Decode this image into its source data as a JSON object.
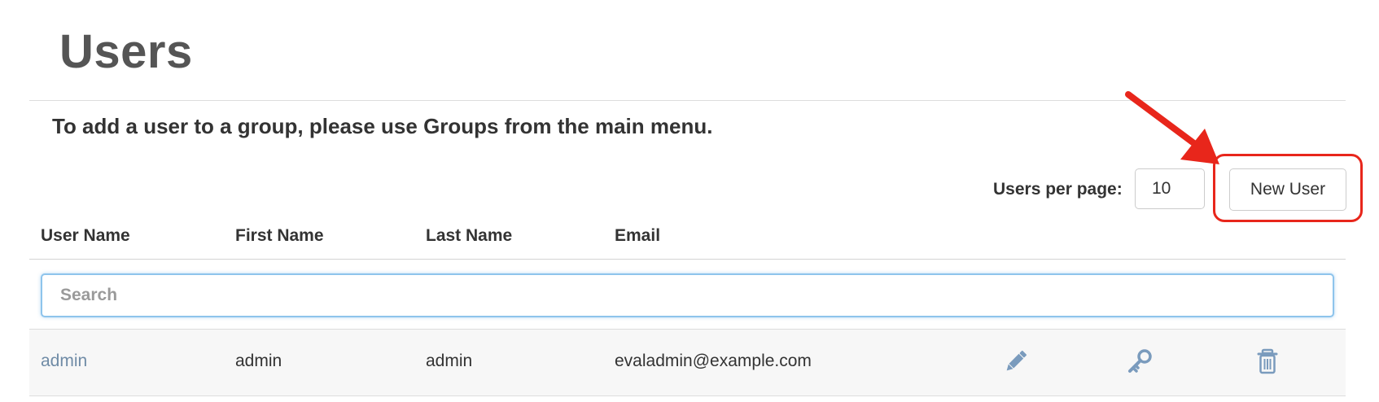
{
  "page": {
    "title": "Users",
    "info_text": "To add a user to a group, please use Groups from the main menu."
  },
  "controls": {
    "per_page_label": "Users per page:",
    "per_page_value": "10",
    "new_user_label": "New User"
  },
  "table": {
    "columns": [
      "User Name",
      "First Name",
      "Last Name",
      "Email"
    ],
    "search_placeholder": "Search",
    "rows": [
      {
        "user_name": "admin",
        "first_name": "admin",
        "last_name": "admin",
        "email": "evaladmin@example.com",
        "actions": [
          "pencil-icon",
          "key-icon",
          "trash-icon"
        ]
      }
    ]
  },
  "colors": {
    "link": "#6f8ba6",
    "icon": "#7a9bbd",
    "annotation": "#e8261b",
    "search_focus": "#8ec4ec"
  }
}
